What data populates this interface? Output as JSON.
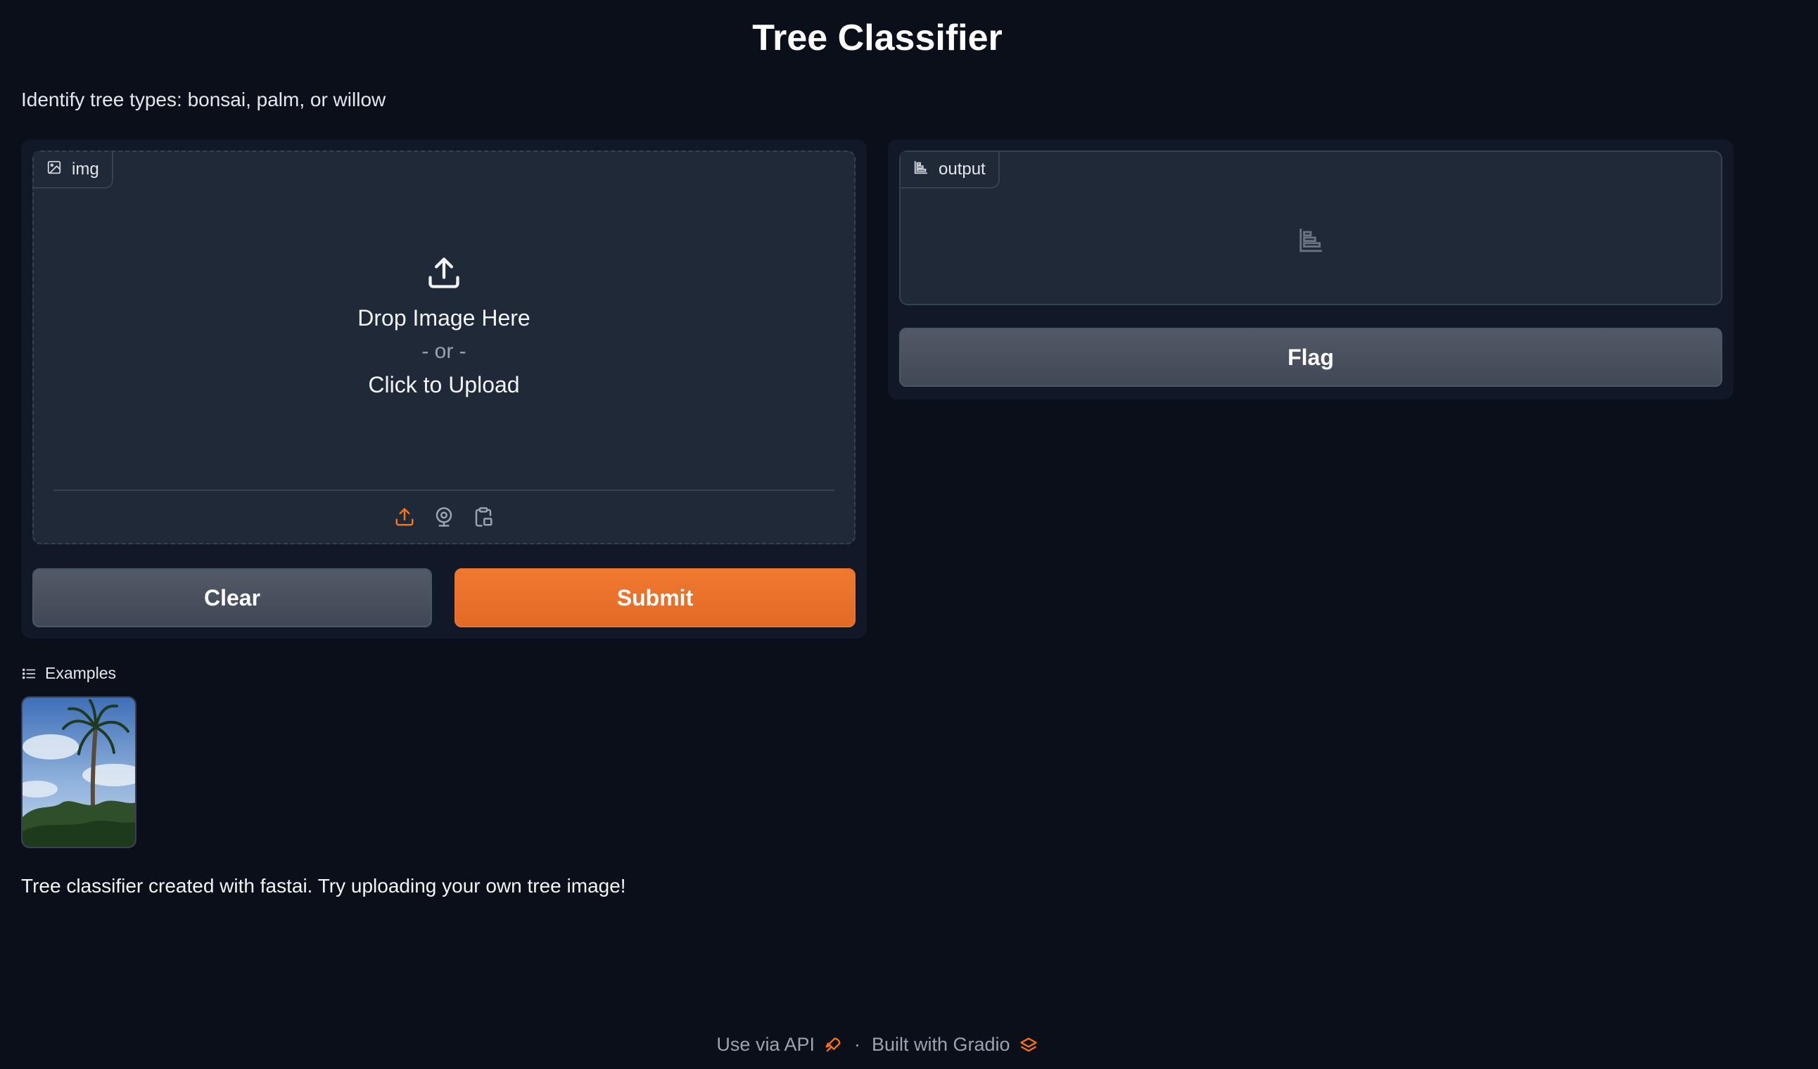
{
  "header": {
    "title": "Tree Classifier",
    "description": "Identify tree types: bonsai, palm, or willow"
  },
  "input": {
    "label": "img",
    "drop_text": "Drop Image Here",
    "or_text": "- or -",
    "click_text": "Click to Upload",
    "sources": [
      "upload-icon",
      "webcam-icon",
      "clipboard-icon"
    ],
    "active_source_color": "#f97316"
  },
  "buttons": {
    "clear": "Clear",
    "submit": "Submit",
    "flag": "Flag"
  },
  "output": {
    "label": "output"
  },
  "examples": {
    "label": "Examples",
    "items": [
      "palm-tree-example-image"
    ]
  },
  "article": "Tree classifier created with fastai. Try uploading your own tree image!",
  "footer": {
    "api_text": "Use via API",
    "separator": "·",
    "built_text": "Built with Gradio"
  },
  "colors": {
    "background": "#0b0f19",
    "panel": "#111827",
    "block": "#1f2937",
    "accent": "#f97316"
  }
}
